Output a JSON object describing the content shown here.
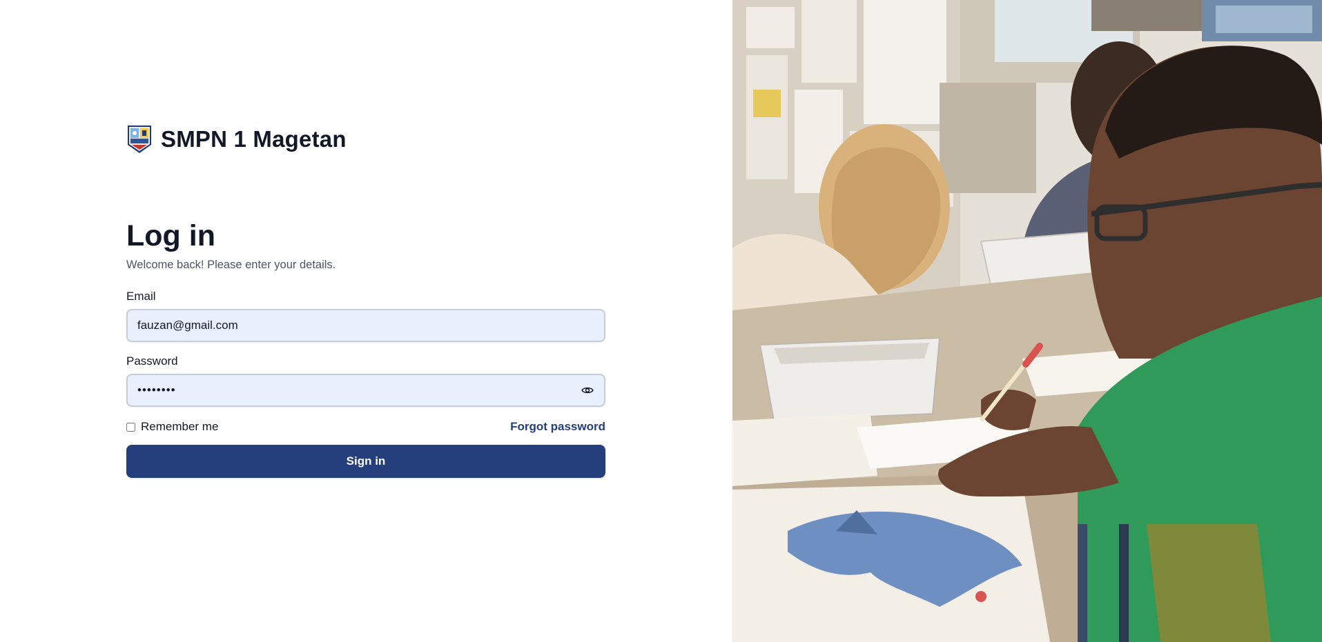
{
  "brand": {
    "name": "SMPN 1 Magetan",
    "logo_icon": "school-crest-icon"
  },
  "login": {
    "title": "Log in",
    "subtitle": "Welcome back! Please enter your details.",
    "email_label": "Email",
    "email_value": "fauzan@gmail.com",
    "password_label": "Password",
    "password_value": "fauzan12",
    "show_password_icon": "eye-icon",
    "remember_label": "Remember me",
    "remember_checked": false,
    "forgot_label": "Forgot password",
    "submit_label": "Sign in"
  },
  "colors": {
    "primary": "#253f7c",
    "input_bg": "#e8f0fe",
    "heading": "#111827",
    "muted": "#4b5563"
  },
  "side_image": {
    "subject": "classroom-photo"
  }
}
